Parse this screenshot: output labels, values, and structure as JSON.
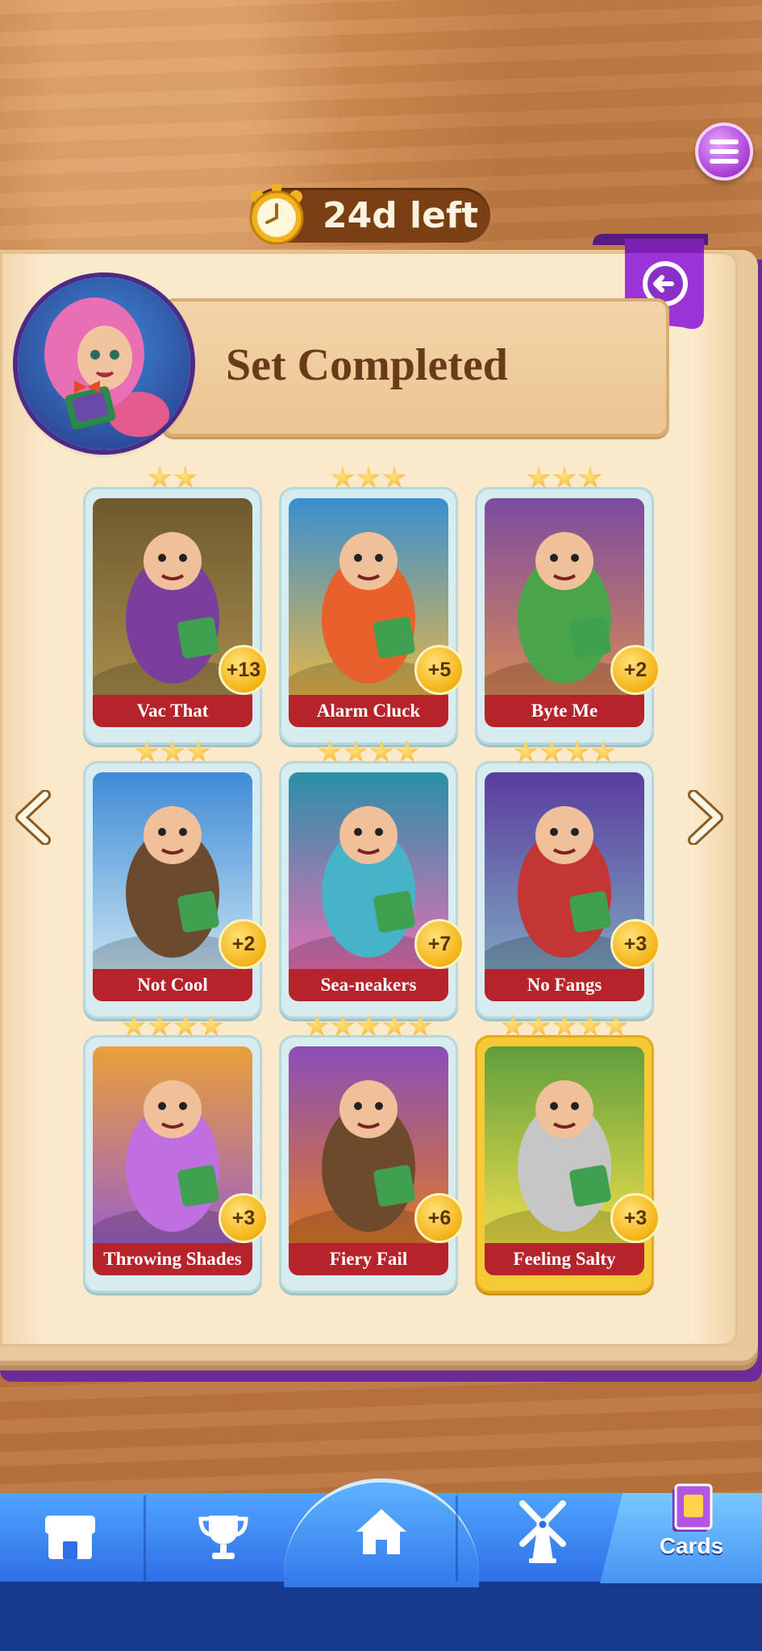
{
  "timer": {
    "text": "24d left"
  },
  "title": {
    "text": "Set Completed"
  },
  "cards": [
    {
      "name": "Vac That",
      "bonus": "+13",
      "stars": 2,
      "gold": false
    },
    {
      "name": "Alarm Cluck",
      "bonus": "+5",
      "stars": 3,
      "gold": false
    },
    {
      "name": "Byte Me",
      "bonus": "+2",
      "stars": 3,
      "gold": false
    },
    {
      "name": "Not Cool",
      "bonus": "+2",
      "stars": 3,
      "gold": false
    },
    {
      "name": "Sea-neakers",
      "bonus": "+7",
      "stars": 4,
      "gold": false
    },
    {
      "name": "No Fangs",
      "bonus": "+3",
      "stars": 4,
      "gold": false
    },
    {
      "name": "Throwing Shades",
      "bonus": "+3",
      "stars": 4,
      "gold": false
    },
    {
      "name": "Fiery Fail",
      "bonus": "+6",
      "stars": 5,
      "gold": false
    },
    {
      "name": "Feeling Salty",
      "bonus": "+3",
      "stars": 5,
      "gold": true
    }
  ],
  "nav": {
    "items": [
      {
        "id": "shop",
        "icon": "shop-icon"
      },
      {
        "id": "leaderboard",
        "icon": "trophy-icon"
      },
      {
        "id": "home",
        "icon": "home-icon"
      },
      {
        "id": "village",
        "icon": "windmill-icon"
      },
      {
        "id": "cards",
        "icon": "card-album-icon",
        "label": "Cards",
        "active": true
      }
    ]
  },
  "colors": {
    "accent_purple": "#8b2fc9",
    "card_label_red": "#b7232b",
    "nav_blue": "#3378ea",
    "bonus_gold": "#f4b316"
  }
}
